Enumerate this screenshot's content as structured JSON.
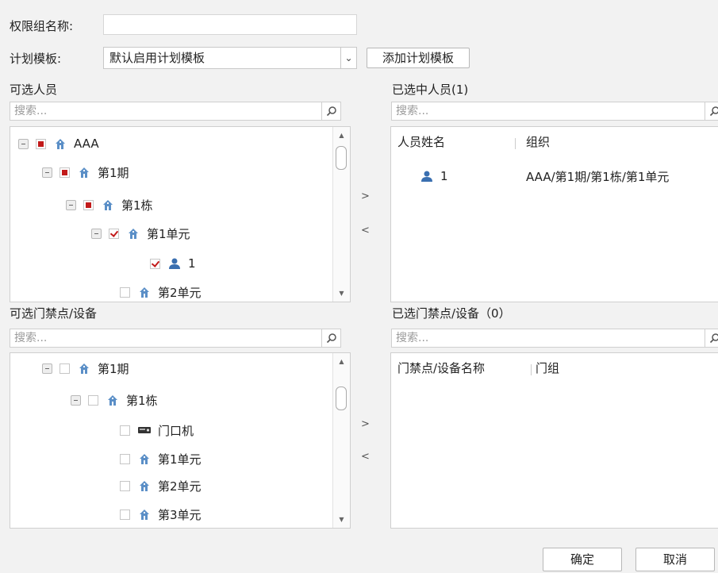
{
  "form": {
    "group_name_label": "权限组名称:",
    "group_name_value": "",
    "schedule_label": "计划模板:",
    "schedule_selected": "默认启用计划模板",
    "add_template_button": "添加计划模板"
  },
  "persons": {
    "available_title": "可选人员",
    "selected_title": "已选中人员(1)",
    "search_placeholder": "搜索...",
    "tree": [
      {
        "label": "AAA",
        "state": "partial",
        "icon": "building-icon"
      },
      {
        "label": "第1期",
        "state": "partial",
        "icon": "building-icon"
      },
      {
        "label": "第1栋",
        "state": "partial",
        "icon": "building-icon"
      },
      {
        "label": "第1单元",
        "state": "checked",
        "icon": "building-icon"
      },
      {
        "label": "1",
        "state": "checked",
        "icon": "person-icon"
      },
      {
        "label": "第2单元",
        "state": "unchecked",
        "icon": "building-icon"
      }
    ],
    "columns": {
      "name": "人员姓名",
      "org": "组织"
    },
    "selected_rows": [
      {
        "name": "1",
        "org": "AAA/第1期/第1栋/第1单元"
      }
    ]
  },
  "devices": {
    "available_title": "可选门禁点/设备",
    "selected_title": "已选门禁点/设备（0）",
    "search_placeholder": "搜索...",
    "tree": [
      {
        "label": "第1期",
        "icon": "building-icon"
      },
      {
        "label": "第1栋",
        "icon": "building-icon"
      },
      {
        "label": "门口机",
        "icon": "door-station-icon"
      },
      {
        "label": "第1单元",
        "icon": "building-icon"
      },
      {
        "label": "第2单元",
        "icon": "building-icon"
      },
      {
        "label": "第3单元",
        "icon": "building-icon"
      }
    ],
    "columns": {
      "name": "门禁点/设备名称",
      "group": "门组"
    }
  },
  "transfer": {
    "add": ">",
    "remove": "<"
  },
  "footer": {
    "ok": "确定",
    "cancel": "取消"
  },
  "colors": {
    "check_red": "#c21a1a",
    "person_blue": "#3a6fb0",
    "building_blue": "#5b8fc7"
  }
}
